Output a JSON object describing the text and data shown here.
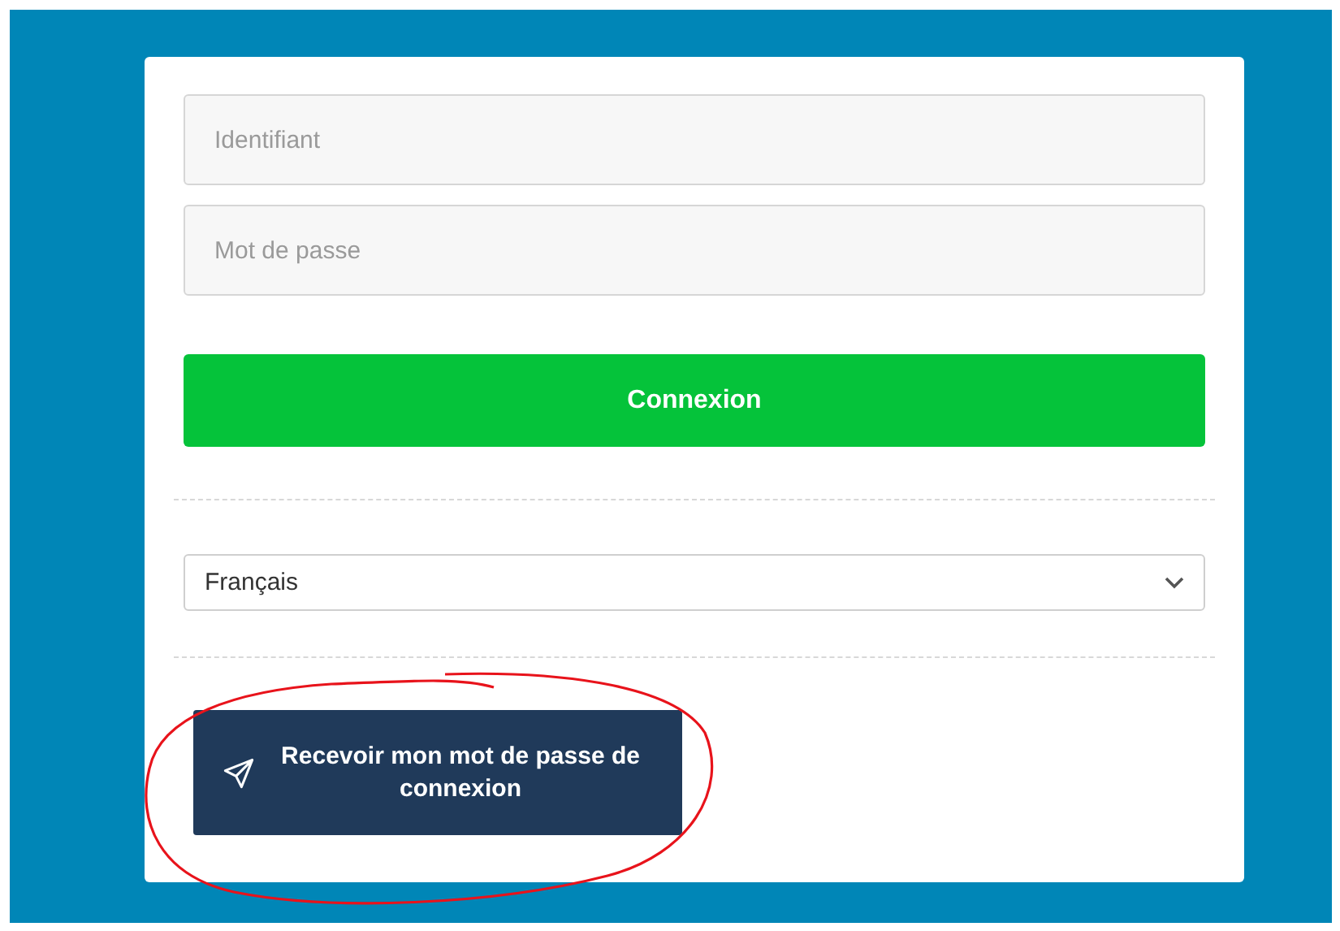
{
  "login_form": {
    "username_field": {
      "placeholder": "Identifiant"
    },
    "password_field": {
      "placeholder": "Mot de passe"
    },
    "submit_button": "Connexion",
    "language_select": {
      "value": "Français"
    },
    "send_password_button": "Recevoir mon mot de passe de connexion"
  }
}
